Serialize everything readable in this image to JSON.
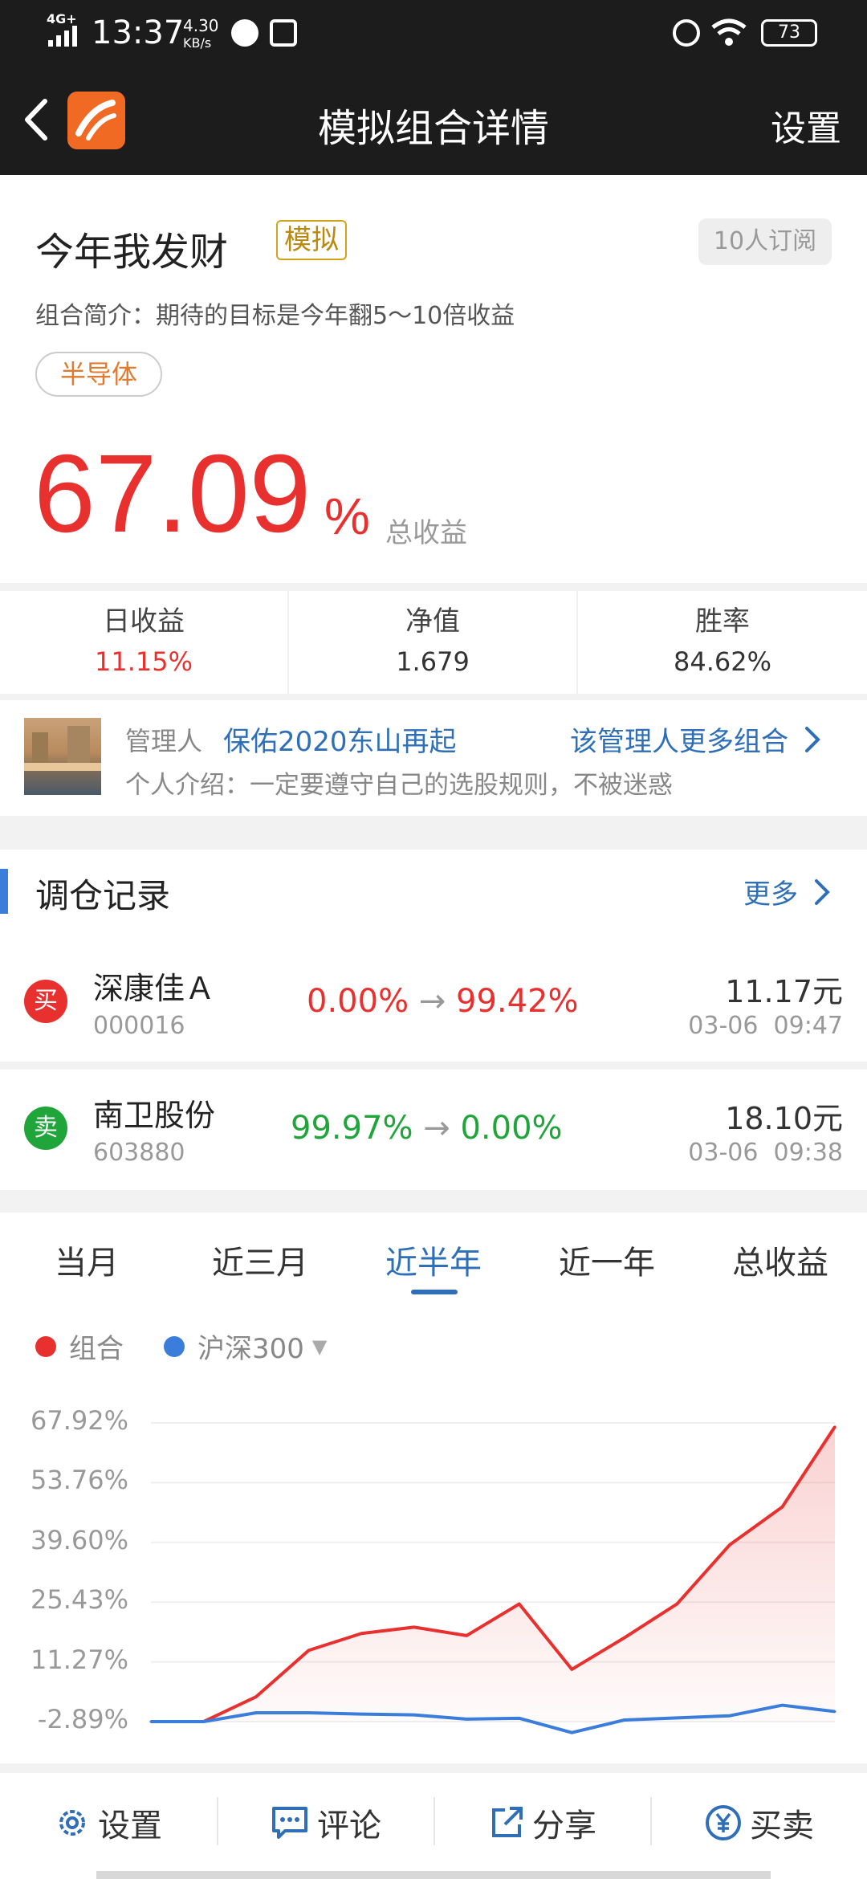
{
  "status_bar": {
    "network": "4G+",
    "time": "13:37",
    "speed_value": "4.30",
    "speed_unit": "KB/s",
    "battery": "73"
  },
  "title_bar": {
    "title": "模拟组合详情",
    "settings_label": "设置"
  },
  "portfolio": {
    "name": "今年我发财",
    "badge": "模拟",
    "subscribers": "10人订阅",
    "intro": "组合简介：期待的目标是今年翻5～10倍收益",
    "tag": "半导体",
    "total_return_value": "67.09",
    "total_return_unit": "%",
    "total_return_label": "总收益"
  },
  "stats": [
    {
      "label": "日收益",
      "value": "11.15%"
    },
    {
      "label": "净值",
      "value": "1.679"
    },
    {
      "label": "胜率",
      "value": "84.62%"
    }
  ],
  "manager": {
    "label": "管理人",
    "name": "保佑2020东山再起",
    "more_link": "该管理人更多组合",
    "bio": "个人介绍：一定要遵守自己的选股规则，不被迷惑"
  },
  "trades_section": {
    "title": "调仓记录",
    "more": "更多"
  },
  "trades": [
    {
      "action": "买",
      "name": "深康佳Ａ",
      "code": "000016",
      "from": "0.00%",
      "to": "99.42%",
      "price": "11.17元",
      "time": "03-06  09:47",
      "color": "#e8312f"
    },
    {
      "action": "卖",
      "name": "南卫股份",
      "code": "603880",
      "from": "99.97%",
      "to": "0.00%",
      "price": "18.10元",
      "time": "03-06  09:38",
      "color": "#1fa539"
    }
  ],
  "period_tabs": [
    "当月",
    "近三月",
    "近半年",
    "近一年",
    "总收益"
  ],
  "active_tab": "近半年",
  "legend": {
    "series1": "组合",
    "series2": "沪深300"
  },
  "chart_data": {
    "type": "area",
    "y_ticks": [
      "67.92%",
      "53.76%",
      "39.60%",
      "25.43%",
      "11.27%",
      "-2.89%"
    ],
    "ylim": [
      -2.89,
      67.92
    ],
    "series": [
      {
        "name": "组合",
        "color": "#e8312f",
        "values": [
          -2.9,
          -2.9,
          3,
          14,
          18,
          19.5,
          17.5,
          25,
          9.5,
          17,
          25,
          39,
          48,
          67
        ]
      },
      {
        "name": "沪深300",
        "color": "#3b7ddb",
        "values": [
          -2.9,
          -2.9,
          -0.8,
          -0.8,
          -1.1,
          -1.3,
          -2.3,
          -2.1,
          -5.5,
          -2.5,
          -2,
          -1.5,
          1,
          -0.5
        ]
      }
    ]
  },
  "bottom_bar": [
    {
      "label": "设置",
      "icon": "gear-icon"
    },
    {
      "label": "评论",
      "icon": "comment-icon"
    },
    {
      "label": "分享",
      "icon": "share-icon"
    },
    {
      "label": "买卖",
      "icon": "yen-icon"
    }
  ],
  "colors": {
    "red": "#e8312f",
    "green": "#1fa539",
    "blue": "#3b7ddb",
    "tag_orange": "#e07a2f"
  }
}
